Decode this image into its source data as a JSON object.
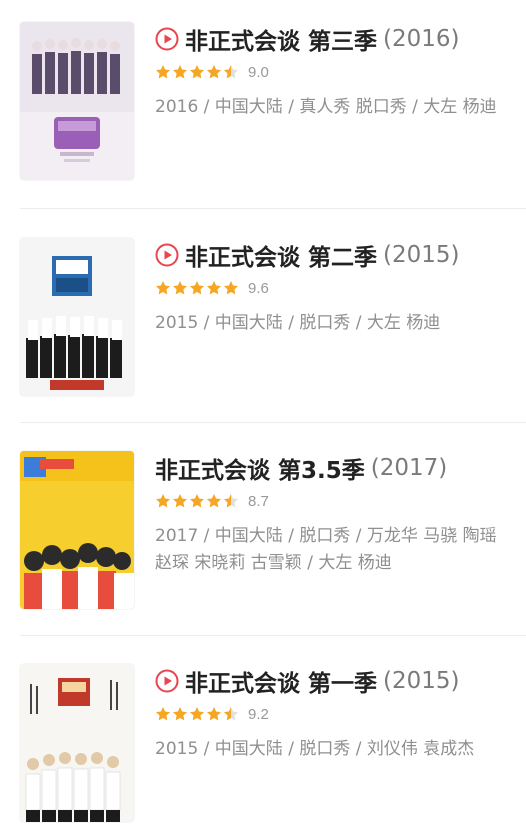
{
  "colors": {
    "accent_red": "#e8454f",
    "star_orange": "#f5a623",
    "star_empty": "#e0e0e0"
  },
  "items": [
    {
      "has_play": true,
      "title": "非正式会谈 第三季",
      "year": "(2016)",
      "rating_stars": 4.5,
      "score": "9.0",
      "meta": "2016 / 中国大陆 / 真人秀 脱口秀 / 大左 杨迪"
    },
    {
      "has_play": true,
      "title": "非正式会谈 第二季",
      "year": "(2015)",
      "rating_stars": 5,
      "score": "9.6",
      "meta": "2015 / 中国大陆 / 脱口秀 / 大左 杨迪"
    },
    {
      "has_play": false,
      "title": "非正式会谈 第3.5季",
      "year": "(2017)",
      "rating_stars": 4.5,
      "score": "8.7",
      "meta": "2017 / 中国大陆 / 脱口秀 / 万龙华 马骁 陶瑶 赵琛 宋晓莉 古雪颖 / 大左 杨迪"
    },
    {
      "has_play": true,
      "title": "非正式会谈 第一季",
      "year": "(2015)",
      "rating_stars": 4.5,
      "score": "9.2",
      "meta": "2015 / 中国大陆 / 脱口秀 / 刘仪伟 袁成杰"
    }
  ]
}
